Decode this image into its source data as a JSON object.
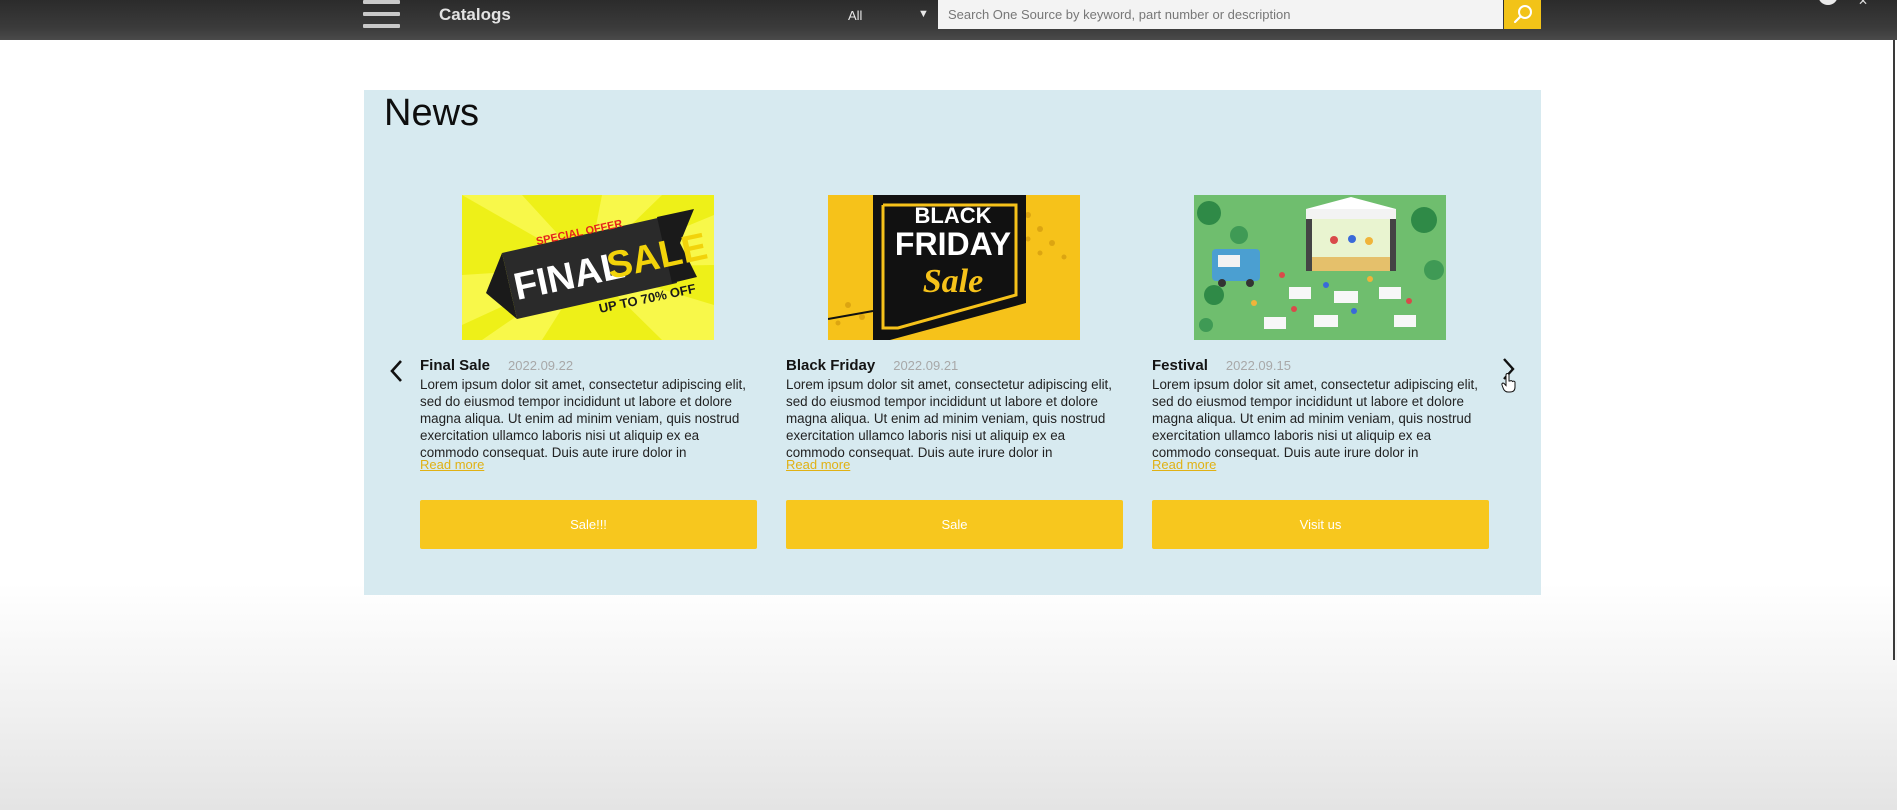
{
  "header": {
    "catalogs_label": "Catalogs",
    "search_scope": "All",
    "search_placeholder": "Search One Source by keyword, part number or description"
  },
  "news": {
    "title": "News",
    "cards": [
      {
        "title": "Final Sale",
        "date": "2022.09.22",
        "description": "Lorem ipsum dolor sit amet, consectetur adipiscing elit, sed do eiusmod tempor incididunt ut labore et dolore magna aliqua. Ut enim ad minim veniam, quis nostrud exercitation ullamco laboris nisi ut aliquip ex ea commodo consequat. Duis aute irure dolor in",
        "read_more": "Read more",
        "button": "Sale!!!",
        "image": {
          "top_text": "SPECIAL OFFER",
          "main_1": "FINAL",
          "main_2": "SALE",
          "sub": "UP TO 70% OFF"
        }
      },
      {
        "title": "Black Friday",
        "date": "2022.09.21",
        "description": "Lorem ipsum dolor sit amet, consectetur adipiscing elit, sed do eiusmod tempor incididunt ut labore et dolore magna aliqua. Ut enim ad minim veniam, quis nostrud exercitation ullamco laboris nisi ut aliquip ex ea commodo consequat. Duis aute irure dolor in",
        "read_more": "Read more",
        "button": "Sale",
        "image": {
          "line1": "BLACK",
          "line2": "FRIDAY",
          "line3": "Sale"
        }
      },
      {
        "title": "Festival",
        "date": "2022.09.15",
        "description": "Lorem ipsum dolor sit amet, consectetur adipiscing elit, sed do eiusmod tempor incididunt ut labore et dolore magna aliqua. Ut enim ad minim veniam, quis nostrud exercitation ullamco laboris nisi ut aliquip ex ea commodo consequat. Duis aute irure dolor in",
        "read_more": "Read more",
        "button": "Visit us"
      }
    ]
  },
  "colors": {
    "accent": "#f7c71e",
    "panel_bg": "#d7eaf0",
    "header_bg": "#3b3b3b"
  },
  "icons": [
    "hamburger-icon",
    "search-icon",
    "chevron-left-icon",
    "chevron-right-icon",
    "hand-cursor-icon"
  ]
}
